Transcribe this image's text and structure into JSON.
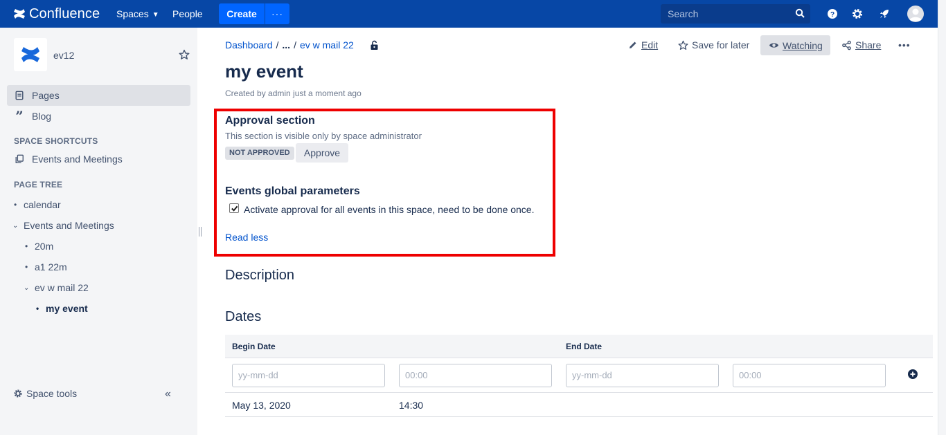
{
  "topnav": {
    "product": "Confluence",
    "spaces": "Spaces",
    "people": "People",
    "create": "Create",
    "more": "···",
    "search_placeholder": "Search"
  },
  "sidebar": {
    "space_name": "ev12",
    "items": [
      {
        "label": "Pages",
        "icon": "page-icon"
      },
      {
        "label": "Blog",
        "icon": "quote-icon"
      }
    ],
    "shortcuts_heading": "SPACE SHORTCUTS",
    "shortcut": "Events and Meetings",
    "tree_heading": "PAGE TREE",
    "tree": [
      "calendar",
      "Events and Meetings",
      "20m",
      "a1 22m",
      "ev w mail 22",
      "my event"
    ],
    "space_tools": "Space tools"
  },
  "breadcrumb": {
    "dashboard": "Dashboard",
    "ellipsis": "...",
    "parent": "ev w mail 22"
  },
  "actions": {
    "edit": "Edit",
    "save_for_later": "Save for later",
    "watching": "Watching",
    "share": "Share",
    "more": "•••"
  },
  "page": {
    "title": "my event",
    "byline": "Created by admin just a moment ago"
  },
  "approval": {
    "title": "Approval section",
    "subtitle": "This section is visible only by space administrator",
    "status": "NOT APPROVED",
    "approve": "Approve",
    "global_title": "Events global parameters",
    "checkbox_label": "Activate approval for all events in this space, need to be done once.",
    "checkbox_checked": true,
    "read_less": "Read less"
  },
  "sections": {
    "description": "Description",
    "dates": "Dates"
  },
  "dates_table": {
    "begin_header": "Begin Date",
    "end_header": "End Date",
    "date_placeholder": "yy-mm-dd",
    "time_placeholder": "00:00",
    "row": {
      "begin_date": "May 13, 2020",
      "begin_time": "14:30"
    }
  },
  "colors": {
    "nav": "#0747a6",
    "create": "#0065ff",
    "link": "#0052cc",
    "highlight": "#ee0000"
  }
}
